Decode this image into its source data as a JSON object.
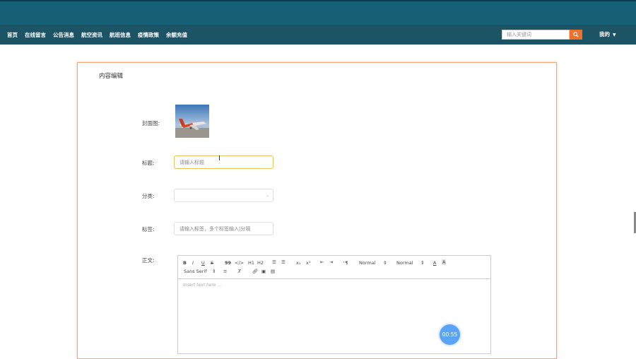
{
  "nav": {
    "items": [
      {
        "label": "首页"
      },
      {
        "label": "在线留言"
      },
      {
        "label": "公告消息"
      },
      {
        "label": "航空资讯"
      },
      {
        "label": "航班信息"
      },
      {
        "label": "疫情政策"
      },
      {
        "label": "余额充值"
      }
    ],
    "search_placeholder": "输入关键词",
    "user_label": "我的"
  },
  "panel": {
    "title": "内容编辑"
  },
  "form": {
    "cover_label": "封面图:",
    "title_label": "标题:",
    "title_placeholder": "请输入标题",
    "category_label": "分类:",
    "category_value": "",
    "tags_label": "标签:",
    "tags_placeholder": "请输入标签，多个标签输入|分隔",
    "body_label": "正文:"
  },
  "editor": {
    "row1": {
      "bold": "B",
      "italic": "I",
      "underline": "U",
      "strike": "S",
      "quote": "99",
      "code": "</>",
      "h1": "H1",
      "h2": "H2",
      "sub": "x₁",
      "sup": "x¹",
      "direction": "⁺¶",
      "size_select": "Normal",
      "header_select": "Normal",
      "color": "A"
    },
    "row2": {
      "font_select": "Sans Serif"
    },
    "placeholder": "Insert text here ..."
  },
  "timer": "00:55",
  "colors": {
    "topbar": "#155f77",
    "navbar": "#1c5466",
    "accent": "#f0712b",
    "panel_border": "#f3a676"
  }
}
